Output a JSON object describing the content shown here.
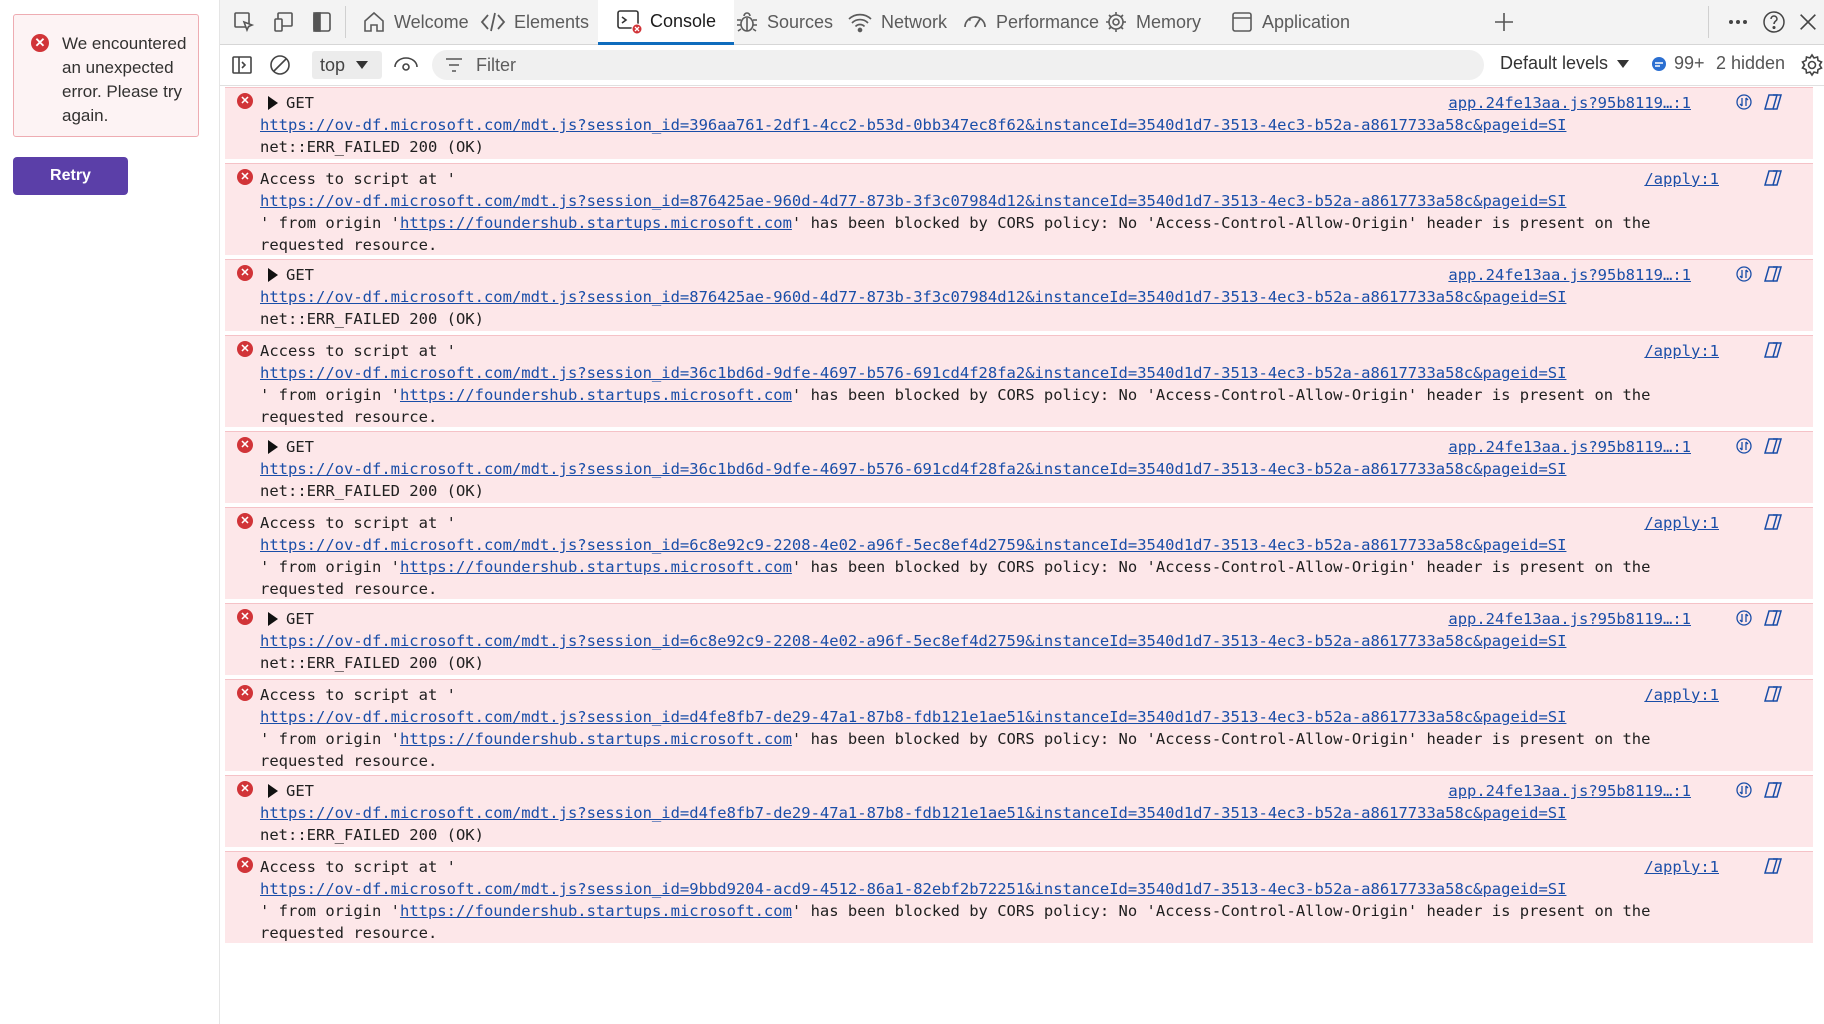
{
  "app": {
    "error_message": "We encountered an unexpected error. Please try again.",
    "retry_label": "Retry"
  },
  "devtools": {
    "tabs": [
      {
        "label": "Welcome",
        "icon": "home-icon"
      },
      {
        "label": "Elements",
        "icon": "code-icon"
      },
      {
        "label": "Console",
        "icon": "console-icon",
        "active": true
      },
      {
        "label": "Sources",
        "icon": "bug-icon"
      },
      {
        "label": "Network",
        "icon": "wifi-icon"
      },
      {
        "label": "Performance",
        "icon": "gauge-icon"
      },
      {
        "label": "Memory",
        "icon": "memory-chip-icon"
      },
      {
        "label": "Application",
        "icon": "application-icon"
      }
    ],
    "toolbar": {
      "context": "top",
      "filter_placeholder": "Filter",
      "levels": "Default levels",
      "message_count": "99+",
      "hidden": "2 hidden"
    }
  },
  "console": {
    "entries": [
      {
        "type": "get",
        "method": "GET",
        "url": "https://ov-df.microsoft.com/mdt.js?session_id=396aa761-2df1-4cc2-b53d-0bb347ec8f62&instanceId=3540d1d7-3513-4ec3-b52a-a8617733a58c&pageid=SI",
        "status": "net::ERR_FAILED 200 (OK)",
        "source": "app.24fe13aa.js?95b8119…:1"
      },
      {
        "type": "cors",
        "prefix": "Access to script at '",
        "url": "https://ov-df.microsoft.com/mdt.js?session_id=876425ae-960d-4d77-873b-3f3c07984d12&instanceId=3540d1d7-3513-4ec3-b52a-a8617733a58c&pageid=SI",
        "mid": "' from origin '",
        "origin": "https://foundershub.startups.microsoft.com",
        "tail": "' has been blocked by CORS policy: No 'Access-Control-Allow-Origin' header is present on the",
        "tail2": "requested resource.",
        "source": "/apply:1"
      },
      {
        "type": "get",
        "method": "GET",
        "url": "https://ov-df.microsoft.com/mdt.js?session_id=876425ae-960d-4d77-873b-3f3c07984d12&instanceId=3540d1d7-3513-4ec3-b52a-a8617733a58c&pageid=SI",
        "status": "net::ERR_FAILED 200 (OK)",
        "source": "app.24fe13aa.js?95b8119…:1"
      },
      {
        "type": "cors",
        "prefix": "Access to script at '",
        "url": "https://ov-df.microsoft.com/mdt.js?session_id=36c1bd6d-9dfe-4697-b576-691cd4f28fa2&instanceId=3540d1d7-3513-4ec3-b52a-a8617733a58c&pageid=SI",
        "mid": "' from origin '",
        "origin": "https://foundershub.startups.microsoft.com",
        "tail": "' has been blocked by CORS policy: No 'Access-Control-Allow-Origin' header is present on the",
        "tail2": "requested resource.",
        "source": "/apply:1"
      },
      {
        "type": "get",
        "method": "GET",
        "url": "https://ov-df.microsoft.com/mdt.js?session_id=36c1bd6d-9dfe-4697-b576-691cd4f28fa2&instanceId=3540d1d7-3513-4ec3-b52a-a8617733a58c&pageid=SI",
        "status": "net::ERR_FAILED 200 (OK)",
        "source": "app.24fe13aa.js?95b8119…:1"
      },
      {
        "type": "cors",
        "prefix": "Access to script at '",
        "url": "https://ov-df.microsoft.com/mdt.js?session_id=6c8e92c9-2208-4e02-a96f-5ec8ef4d2759&instanceId=3540d1d7-3513-4ec3-b52a-a8617733a58c&pageid=SI",
        "mid": "' from origin '",
        "origin": "https://foundershub.startups.microsoft.com",
        "tail": "' has been blocked by CORS policy: No 'Access-Control-Allow-Origin' header is present on the",
        "tail2": "requested resource.",
        "source": "/apply:1"
      },
      {
        "type": "get",
        "method": "GET",
        "url": "https://ov-df.microsoft.com/mdt.js?session_id=6c8e92c9-2208-4e02-a96f-5ec8ef4d2759&instanceId=3540d1d7-3513-4ec3-b52a-a8617733a58c&pageid=SI",
        "status": "net::ERR_FAILED 200 (OK)",
        "source": "app.24fe13aa.js?95b8119…:1"
      },
      {
        "type": "cors",
        "prefix": "Access to script at '",
        "url": "https://ov-df.microsoft.com/mdt.js?session_id=d4fe8fb7-de29-47a1-87b8-fdb121e1ae51&instanceId=3540d1d7-3513-4ec3-b52a-a8617733a58c&pageid=SI",
        "mid": "' from origin '",
        "origin": "https://foundershub.startups.microsoft.com",
        "tail": "' has been blocked by CORS policy: No 'Access-Control-Allow-Origin' header is present on the",
        "tail2": "requested resource.",
        "source": "/apply:1"
      },
      {
        "type": "get",
        "method": "GET",
        "url": "https://ov-df.microsoft.com/mdt.js?session_id=d4fe8fb7-de29-47a1-87b8-fdb121e1ae51&instanceId=3540d1d7-3513-4ec3-b52a-a8617733a58c&pageid=SI",
        "status": "net::ERR_FAILED 200 (OK)",
        "source": "app.24fe13aa.js?95b8119…:1"
      },
      {
        "type": "cors",
        "prefix": "Access to script at '",
        "url": "https://ov-df.microsoft.com/mdt.js?session_id=9bbd9204-acd9-4512-86a1-82ebf2b72251&instanceId=3540d1d7-3513-4ec3-b52a-a8617733a58c&pageid=SI",
        "mid": "' from origin '",
        "origin": "https://foundershub.startups.microsoft.com",
        "tail": "' has been blocked by CORS policy: No 'Access-Control-Allow-Origin' header is present on the",
        "tail2": "requested resource.",
        "source": "/apply:1"
      }
    ]
  },
  "colors": {
    "retry_bg": "#5b3fa8",
    "error_red": "#d13438",
    "error_row_bg": "#fde7e9",
    "link_blue": "#1a4ea8",
    "active_tab_underline": "#0f6cbd"
  }
}
